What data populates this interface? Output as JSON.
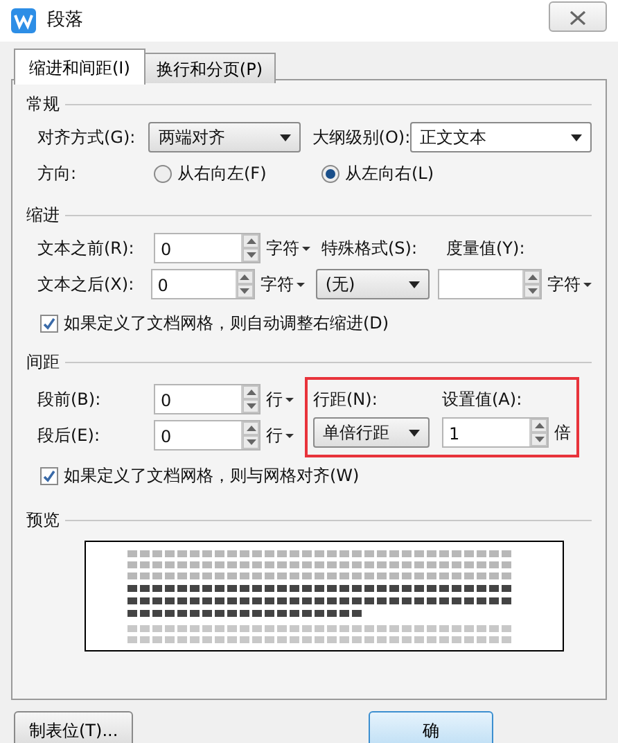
{
  "window": {
    "title": "段落"
  },
  "tabs": [
    {
      "label": "缩进和间距(I)",
      "selected": true
    },
    {
      "label": "换行和分页(P)",
      "selected": false
    }
  ],
  "general": {
    "title": "常规",
    "alignment": {
      "label": "对齐方式(G):",
      "value": "两端对齐"
    },
    "outline": {
      "label": "大纲级别(O):",
      "value": "正文文本"
    },
    "direction": {
      "label": "方向:",
      "options": [
        {
          "label": "从右向左(F)",
          "selected": false
        },
        {
          "label": "从左向右(L)",
          "selected": true
        }
      ]
    }
  },
  "indent": {
    "title": "缩进",
    "before": {
      "label": "文本之前(R):",
      "value": "0",
      "unit": "字符"
    },
    "after": {
      "label": "文本之后(X):",
      "value": "0",
      "unit": "字符"
    },
    "special": {
      "label": "特殊格式(S):",
      "value": "(无)"
    },
    "measure": {
      "label": "度量值(Y):",
      "unit": "字符"
    },
    "auto_adjust": {
      "label": "如果定义了文档网格，则自动调整右缩进(D)",
      "checked": true
    }
  },
  "spacing": {
    "title": "间距",
    "before": {
      "label": "段前(B):",
      "value": "0",
      "unit": "行"
    },
    "after": {
      "label": "段后(E):",
      "value": "0",
      "unit": "行"
    },
    "line_group": {
      "highlighted": true,
      "line_spacing": {
        "label": "行距(N):",
        "value": "单倍行距"
      },
      "set_value": {
        "label": "设置值(A):",
        "value": "1",
        "unit": "倍"
      }
    },
    "snap_grid": {
      "label": "如果定义了文档网格，则与网格对齐(W)",
      "checked": true
    }
  },
  "preview": {
    "title": "预览"
  },
  "buttons": [
    {
      "label": "制表位(T)...",
      "default": false
    },
    {
      "label": "确",
      "default": true
    }
  ]
}
